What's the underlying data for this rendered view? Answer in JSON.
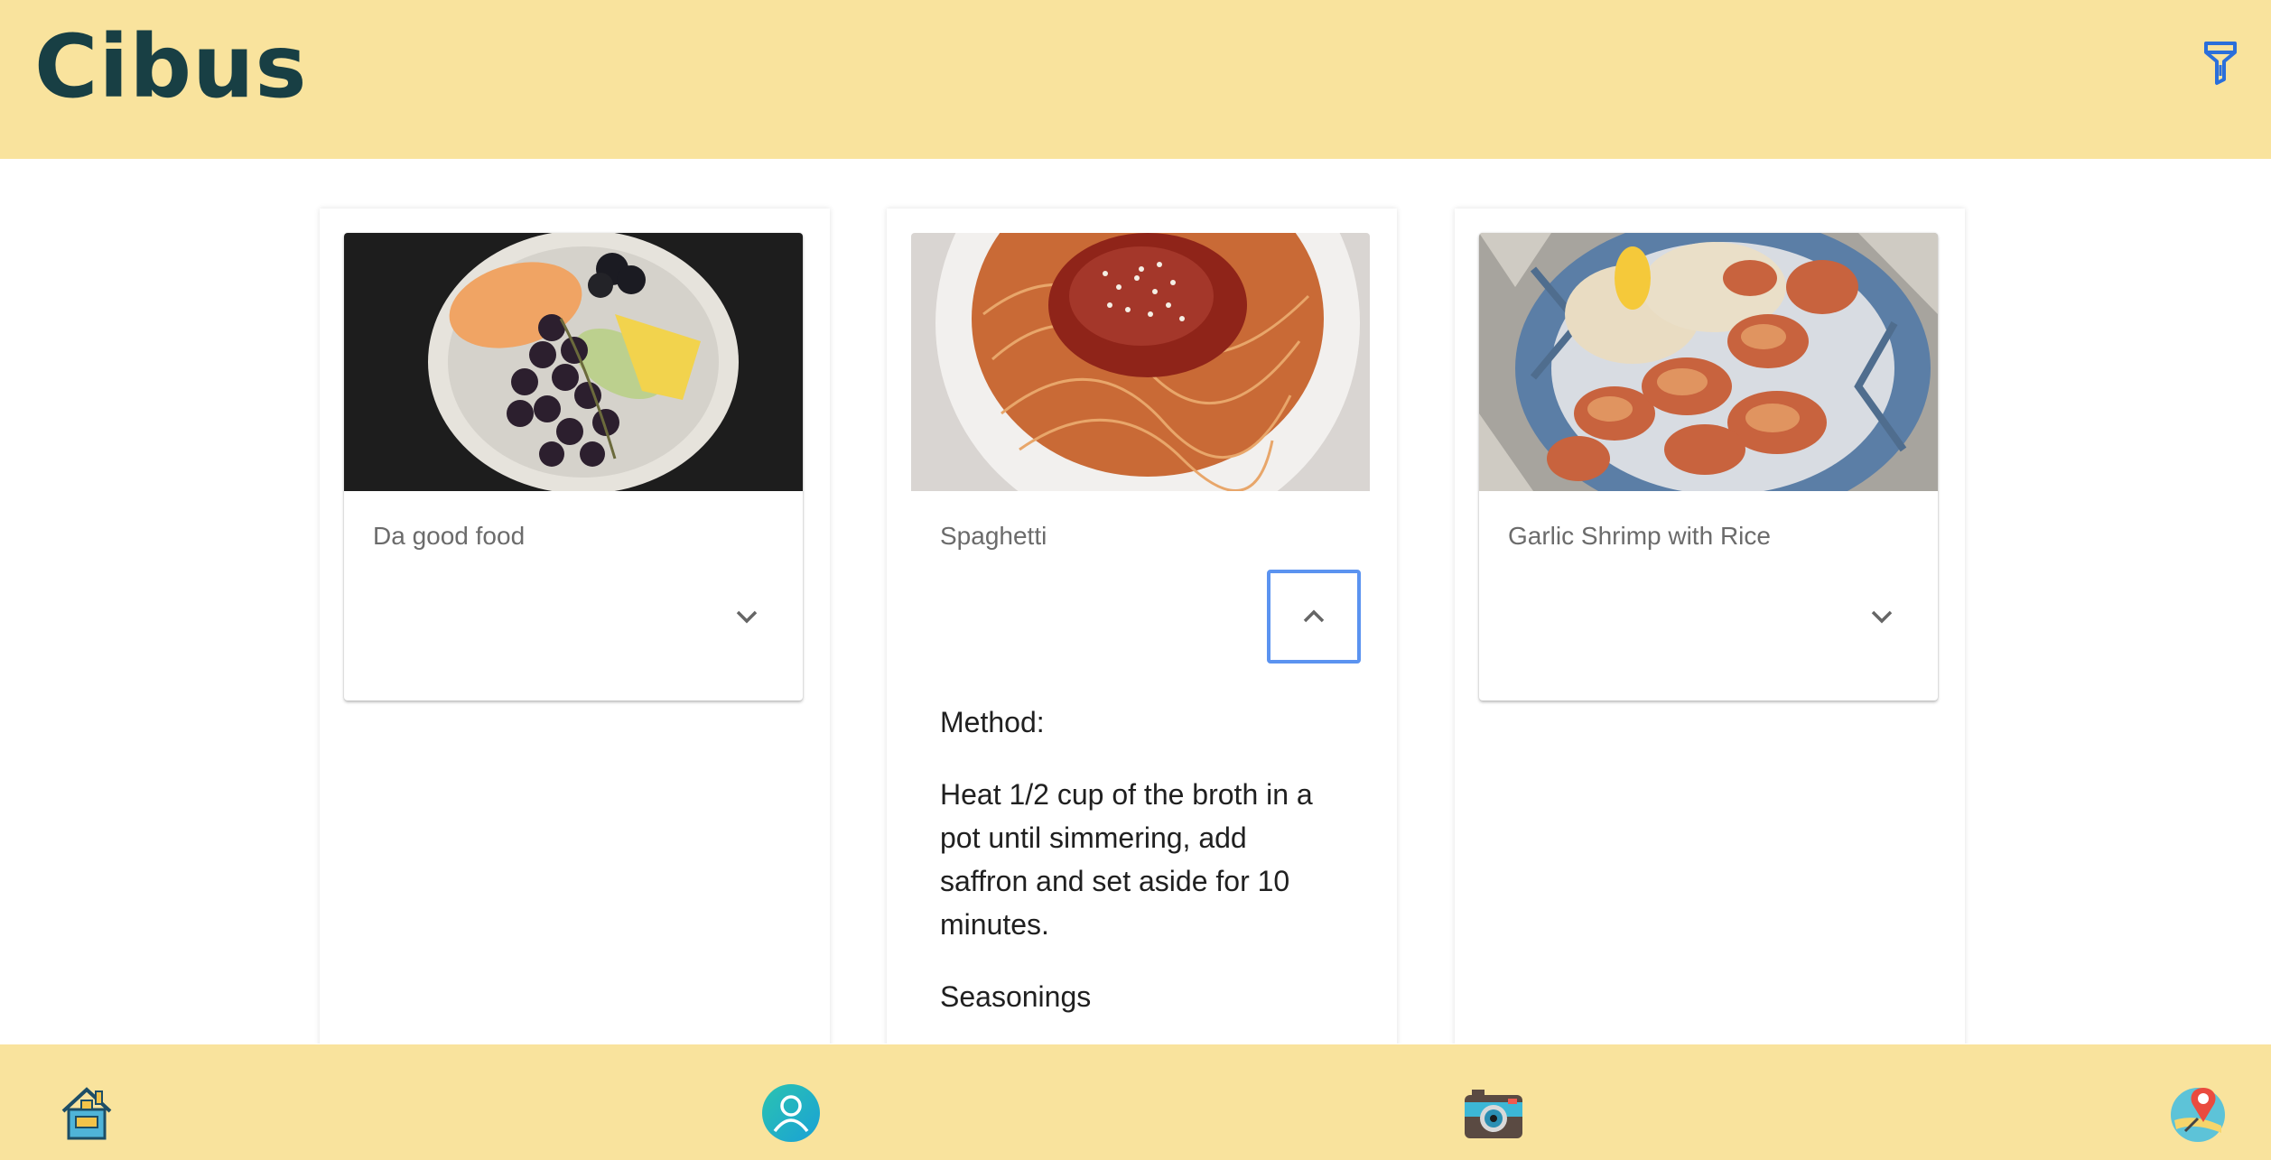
{
  "app": {
    "title": "Cibus"
  },
  "header": {
    "filter_icon": "filter-icon"
  },
  "recipes": [
    {
      "title": "Da good food",
      "image": "fruit-plate-photo",
      "expanded": false,
      "toggle_icon": "chevron-down-icon"
    },
    {
      "title": "Spaghetti",
      "image": "spaghetti-photo",
      "expanded": true,
      "toggle_icon": "chevron-up-icon",
      "method_label": "Method:",
      "method_text": "Heat 1/2 cup of the broth in a pot until simmering, add saffron and set aside for 10 minutes.",
      "seasonings_label": "Seasonings"
    },
    {
      "title": "Garlic Shrimp with Rice",
      "image": "garlic-shrimp-photo",
      "expanded": false,
      "toggle_icon": "chevron-down-icon"
    }
  ],
  "bottom_nav": {
    "items": [
      {
        "icon": "home-icon"
      },
      {
        "icon": "profile-icon"
      },
      {
        "icon": "camera-icon"
      },
      {
        "icon": "map-pin-icon"
      }
    ]
  },
  "colors": {
    "header_bg": "#f9e39d",
    "logo": "#183f44",
    "accent_blue": "#2a6fdb",
    "focus_ring": "#5b93f0"
  }
}
